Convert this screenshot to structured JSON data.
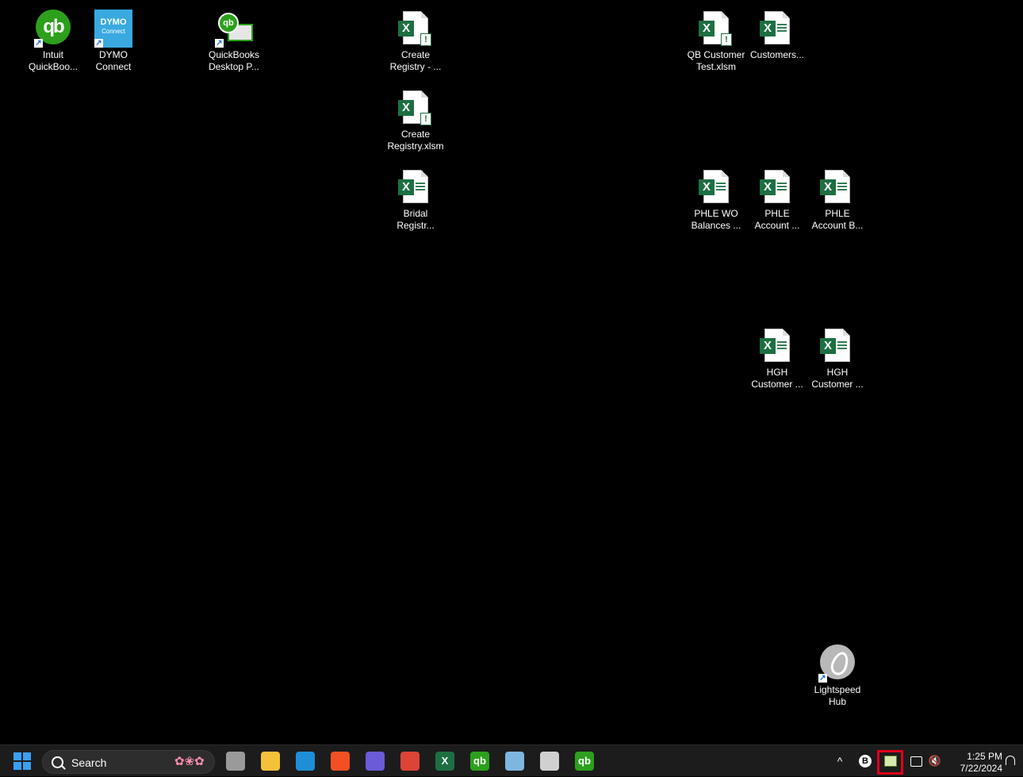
{
  "desktop": {
    "icons": [
      {
        "label": "Intuit\nQuickBoo...",
        "icon": "quickbooks-icon",
        "shortcut": true
      },
      {
        "label": "DYMO\nConnect",
        "icon": "dymo-connect-icon",
        "shortcut": true,
        "logo_text_1": "DYMO",
        "logo_text_2": "Connect"
      },
      {
        "label": "QuickBooks\nDesktop P...",
        "icon": "quickbooks-desktop-icon",
        "shortcut": true
      },
      {
        "label": "Create\nRegistry - ...",
        "icon": "excel-macro-file-icon"
      },
      {
        "label": "Create\nRegistry.xlsm",
        "icon": "excel-macro-file-icon"
      },
      {
        "label": "Bridal\nRegistr...",
        "icon": "excel-file-icon"
      },
      {
        "label": "QB Customer\nTest.xlsm",
        "icon": "excel-macro-file-icon"
      },
      {
        "label": "Customers...",
        "icon": "excel-file-icon"
      },
      {
        "label": "PHLE WO\nBalances ...",
        "icon": "excel-file-icon"
      },
      {
        "label": "PHLE\nAccount ...",
        "icon": "excel-file-icon"
      },
      {
        "label": "PHLE\nAccount B...",
        "icon": "excel-file-icon"
      },
      {
        "label": "HGH\nCustomer ...",
        "icon": "excel-file-icon"
      },
      {
        "label": "HGH\nCustomer ...",
        "icon": "excel-file-icon"
      },
      {
        "label": "Lightspeed\nHub",
        "icon": "lightspeed-icon",
        "shortcut": true
      }
    ]
  },
  "taskbar": {
    "start": "windows-start-icon",
    "search": {
      "label": "Search"
    },
    "pinned": [
      {
        "name": "task-view-icon",
        "glyph": "",
        "color": "#9a9a9a"
      },
      {
        "name": "file-explorer-icon",
        "glyph": "",
        "color": "#f3c13a"
      },
      {
        "name": "edge-icon",
        "glyph": "",
        "color": "#1e8fd6"
      },
      {
        "name": "microsoft-store-icon",
        "glyph": "",
        "color": "#f25022"
      },
      {
        "name": "copilot-icon",
        "glyph": "",
        "color": "#6b5bd6"
      },
      {
        "name": "chrome-icon",
        "glyph": "",
        "color": "#db4437"
      },
      {
        "name": "excel-icon",
        "glyph": "X",
        "color": "#1d6f42"
      },
      {
        "name": "quickbooks-icon",
        "glyph": "qb",
        "color": "#2ca01c"
      },
      {
        "name": "monitor-app-icon",
        "glyph": "",
        "color": "#7fb6e0"
      },
      {
        "name": "snipping-tool-icon",
        "glyph": "",
        "color": "#d0d0d0"
      },
      {
        "name": "quickbooks-desktop-icon",
        "glyph": "qb",
        "color": "#2ca01c"
      }
    ],
    "tray": {
      "overflow_glyph": "^",
      "b_badge": "B",
      "clock_time": "1:25 PM",
      "clock_date": "7/22/2024",
      "mute_glyph": "🔇",
      "highlight_color": "#e0001b"
    }
  }
}
